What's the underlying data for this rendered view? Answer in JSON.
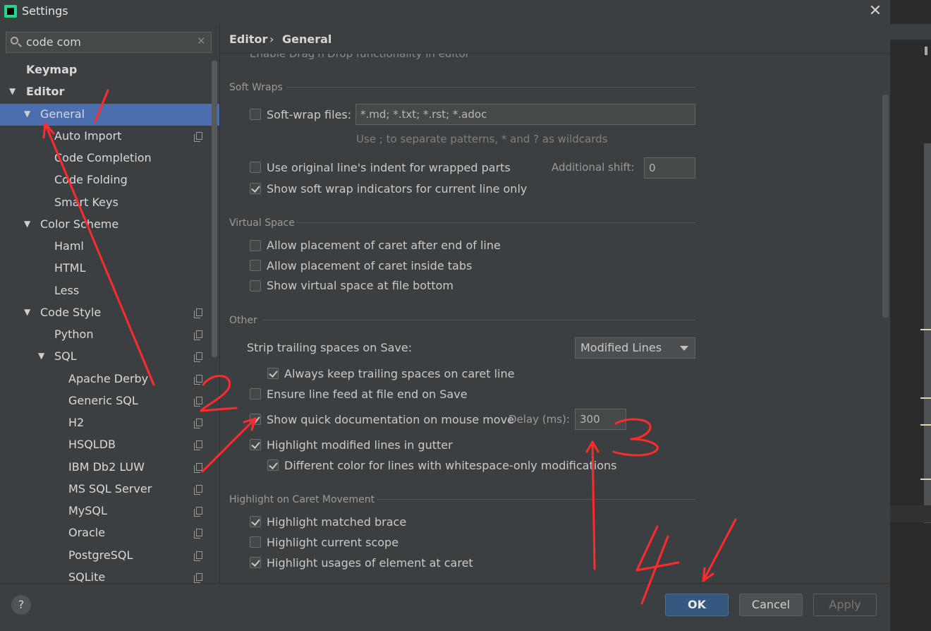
{
  "window": {
    "title": "Settings"
  },
  "search": {
    "value": "code com"
  },
  "sidebar": {
    "items": [
      {
        "label": "Keymap",
        "depth": 0,
        "bold": true,
        "arrow": false,
        "project": false
      },
      {
        "label": "Editor",
        "depth": 0,
        "bold": true,
        "arrow": true,
        "project": false
      },
      {
        "label": "General",
        "depth": 1,
        "arrow": true,
        "project": false,
        "selected": true
      },
      {
        "label": "Auto Import",
        "depth": 2,
        "arrow": false,
        "project": true
      },
      {
        "label": "Code Completion",
        "depth": 2,
        "arrow": false,
        "project": false
      },
      {
        "label": "Code Folding",
        "depth": 2,
        "arrow": false,
        "project": false
      },
      {
        "label": "Smart Keys",
        "depth": 2,
        "arrow": false,
        "project": false
      },
      {
        "label": "Color Scheme",
        "depth": 1,
        "arrow": true,
        "project": false
      },
      {
        "label": "Haml",
        "depth": 2,
        "arrow": false,
        "project": false
      },
      {
        "label": "HTML",
        "depth": 2,
        "arrow": false,
        "project": false
      },
      {
        "label": "Less",
        "depth": 2,
        "arrow": false,
        "project": false
      },
      {
        "label": "Code Style",
        "depth": 1,
        "arrow": true,
        "project": true
      },
      {
        "label": "Python",
        "depth": 2,
        "arrow": false,
        "project": true
      },
      {
        "label": "SQL",
        "depth": 2,
        "arrow": true,
        "project": true
      },
      {
        "label": "Apache Derby",
        "depth": 3,
        "arrow": false,
        "project": true
      },
      {
        "label": "Generic SQL",
        "depth": 3,
        "arrow": false,
        "project": true
      },
      {
        "label": "H2",
        "depth": 3,
        "arrow": false,
        "project": true
      },
      {
        "label": "HSQLDB",
        "depth": 3,
        "arrow": false,
        "project": true
      },
      {
        "label": "IBM Db2 LUW",
        "depth": 3,
        "arrow": false,
        "project": true
      },
      {
        "label": "MS SQL Server",
        "depth": 3,
        "arrow": false,
        "project": true
      },
      {
        "label": "MySQL",
        "depth": 3,
        "arrow": false,
        "project": true
      },
      {
        "label": "Oracle",
        "depth": 3,
        "arrow": false,
        "project": true
      },
      {
        "label": "PostgreSQL",
        "depth": 3,
        "arrow": false,
        "project": true
      },
      {
        "label": "SQLite",
        "depth": 3,
        "arrow": false,
        "project": true
      }
    ]
  },
  "breadcrumb": {
    "parent": "Editor",
    "separator": "›",
    "current": "General"
  },
  "content": {
    "cut_off_text": "Enable Drag'n'Drop functionality in editor",
    "soft_wraps": {
      "title": "Soft Wraps",
      "soft_wrap_files_label": "Soft-wrap files:",
      "soft_wrap_files_value": "*.md; *.txt; *.rst; *.adoc",
      "hint": "Use ; to separate patterns, * and ? as wildcards",
      "original_indent_label": "Use original line's indent for wrapped parts",
      "additional_shift_label": "Additional shift:",
      "additional_shift_value": "0",
      "indicators_label": "Show soft wrap indicators for current line only"
    },
    "virtual_space": {
      "title": "Virtual Space",
      "after_end_label": "Allow placement of caret after end of line",
      "inside_tabs_label": "Allow placement of caret inside tabs",
      "file_bottom_label": "Show virtual space at file bottom"
    },
    "other": {
      "title": "Other",
      "strip_label": "Strip trailing spaces on Save:",
      "strip_value": "Modified Lines",
      "keep_trailing_label": "Always keep trailing spaces on caret line",
      "line_feed_label": "Ensure line feed at file end on Save",
      "quick_doc_label": "Show quick documentation on mouse move",
      "delay_label": "Delay (ms):",
      "delay_value": "300",
      "highlight_modified_label": "Highlight modified lines in gutter",
      "whitespace_color_label": "Different color for lines with whitespace-only modifications"
    },
    "caret_movement": {
      "title": "Highlight on Caret Movement",
      "matched_brace_label": "Highlight matched brace",
      "current_scope_label": "Highlight current scope",
      "usages_label": "Highlight usages of element at caret"
    }
  },
  "buttons": {
    "help": "?",
    "ok": "OK",
    "cancel": "Cancel",
    "apply": "Apply"
  },
  "annotations": {
    "n1": "1",
    "n2": "2",
    "n3": "3",
    "n4": "4"
  },
  "colors": {
    "accent": "#4b6eaf",
    "annotation": "#ff2a2a",
    "ok_button": "#365880"
  }
}
